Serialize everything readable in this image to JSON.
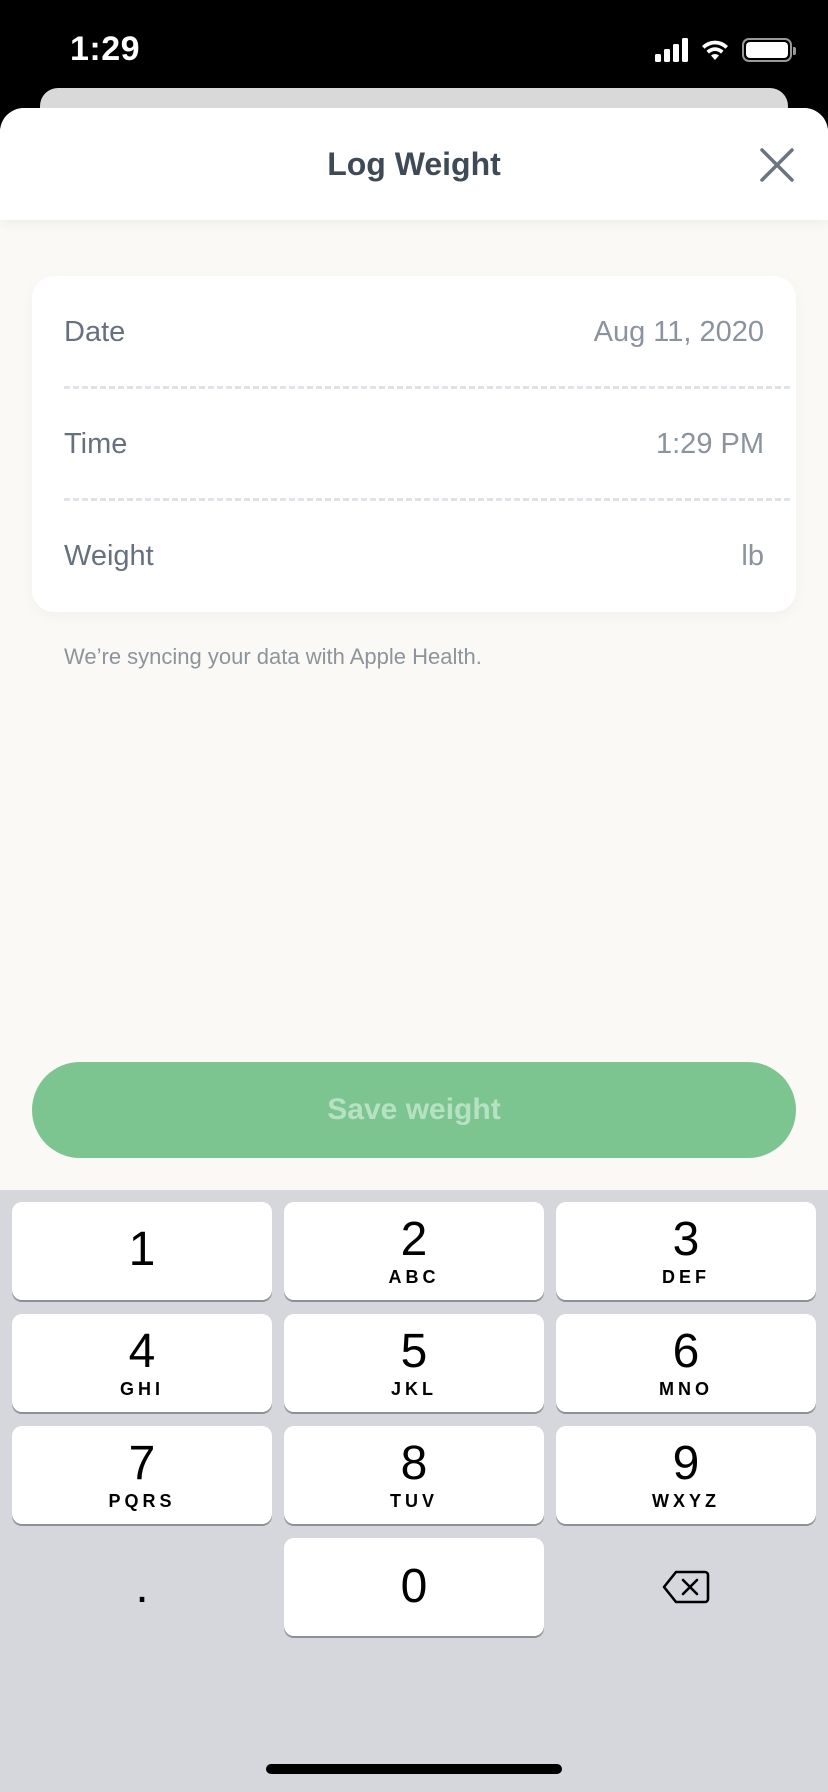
{
  "status_bar": {
    "time": "1:29"
  },
  "modal": {
    "title": "Log Weight",
    "rows": [
      {
        "label": "Date",
        "value": "Aug 11, 2020"
      },
      {
        "label": "Time",
        "value": "1:29 PM"
      },
      {
        "label": "Weight",
        "value": "lb"
      }
    ],
    "sync_note": "We’re syncing your data with Apple Health.",
    "save_label": "Save weight"
  },
  "colors": {
    "accent_green": "#7dc590",
    "title_text": "#3f4a57",
    "keypad_bg": "#d5d7dc"
  },
  "keypad": {
    "keys": [
      {
        "digit": "1",
        "letters": ""
      },
      {
        "digit": "2",
        "letters": "ABC"
      },
      {
        "digit": "3",
        "letters": "DEF"
      },
      {
        "digit": "4",
        "letters": "GHI"
      },
      {
        "digit": "5",
        "letters": "JKL"
      },
      {
        "digit": "6",
        "letters": "MNO"
      },
      {
        "digit": "7",
        "letters": "PQRS"
      },
      {
        "digit": "8",
        "letters": "TUV"
      },
      {
        "digit": "9",
        "letters": "WXYZ"
      },
      {
        "digit": ".",
        "letters": ""
      },
      {
        "digit": "0",
        "letters": ""
      }
    ],
    "backspace_icon": "delete-backspace-icon"
  }
}
